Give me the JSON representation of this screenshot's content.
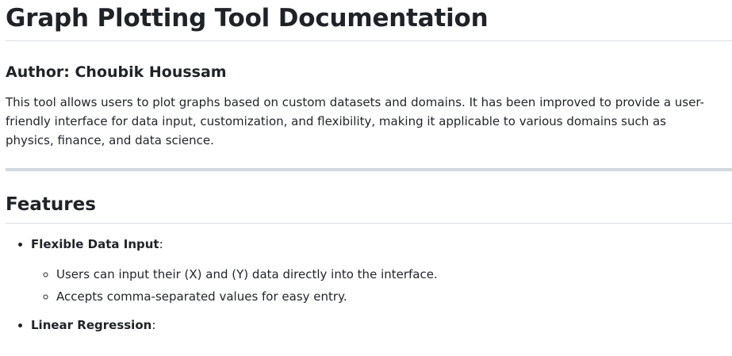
{
  "document": {
    "title": "Graph Plotting Tool Documentation",
    "author_heading": "Author: Choubik Houssam",
    "intro": "This tool allows users to plot graphs based on custom datasets and domains. It has been improved to provide a user-friendly interface for data input, customization, and flexibility, making it applicable to various domains such as physics, finance, and data science.",
    "features_heading": "Features",
    "features": [
      {
        "label": "Flexible Data Input",
        "suffix": ":",
        "subitems": [
          "Users can input their (X) and (Y) data directly into the interface.",
          "Accepts comma-separated values for easy entry."
        ]
      },
      {
        "label": "Linear Regression",
        "suffix": ":"
      }
    ]
  }
}
